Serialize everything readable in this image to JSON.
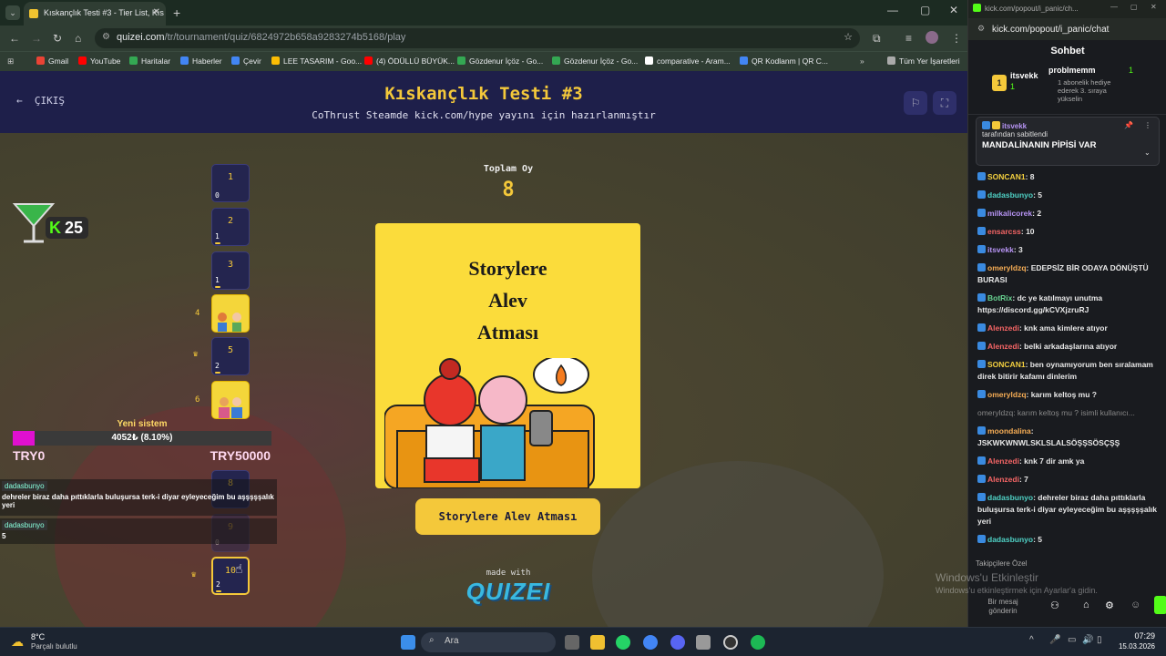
{
  "browser": {
    "tab_title": "Kıskançlık Testi #3 - Tier List, Kıs",
    "url_domain": "quizei.com",
    "url_path": "/tr/tournament/quiz/6824972b658a9283274b5168/play",
    "bookmarks": [
      "Gmail",
      "YouTube",
      "Haritalar",
      "Haberler",
      "Çevir",
      "LEE TASARIM - Goo...",
      "(4) ÖDÜLLÜ BÜYÜK...",
      "Gözdenur İçöz - Go...",
      "Gözdenur İçöz - Go...",
      "comparative - Aram...",
      "QR Kodlanm | QR C..."
    ],
    "bookmarks_all": "Tüm Yer İşaretleri"
  },
  "quiz": {
    "exit_label": "ÇIKIŞ",
    "title": "Kıskançlık Testi #3",
    "subtitle": "CoThrust Steamde kick.com/hype yayını için hazırlanmıştır",
    "votes_label": "Toplam Oy",
    "votes_total": "8",
    "card_text": "Storylere\nAlev\nAtması",
    "answer_label": "Storylere Alev Atması",
    "made_with": "made with",
    "logo": "QUIZEI",
    "slots": [
      {
        "num": "1",
        "count": "0"
      },
      {
        "num": "2",
        "count": "1"
      },
      {
        "num": "3",
        "count": "1"
      },
      {
        "num": "",
        "count": "",
        "label": "4"
      },
      {
        "num": "5",
        "count": "2"
      },
      {
        "num": "",
        "count": "",
        "label": "6"
      },
      {
        "num": "8",
        "count": ""
      },
      {
        "num": "9",
        "count": "0"
      },
      {
        "num": "10",
        "count": "2"
      }
    ]
  },
  "overlay": {
    "goal_count": "25",
    "new_system": "Yeni sistem",
    "progress_text": "4052₺ (8.10%)",
    "progress_fraction": 0.081,
    "left_label": "TRY0",
    "right_label": "TRY50000",
    "chat": [
      {
        "user": "dadasbunyo",
        "text": "dehreler biraz daha pıttıklarla buluşursa terk-i diyar eyleyeceğim bu aşşşşşalık yeri"
      },
      {
        "user": "dadasbunyo",
        "text": "5"
      }
    ]
  },
  "chat": {
    "popout_url_small": "kick.com/popout/i_panic/ch...",
    "popout_url": "kick.com/popout/i_panic/chat",
    "title": "Sohbet",
    "gift_user1": "itsvekk",
    "gift_user1_count": "1",
    "gift_user2": "probImemm",
    "gift_user2_count": "1",
    "gift_note": "1 abonelik hediye ederek 3. sıraya yükselin",
    "pinned_by": "itsvekk",
    "pinned_by_text": "tarafından sabitlendi",
    "pinned_msg": "MANDALİNANIN PİPİSİ VAR",
    "messages": [
      {
        "user": "SONCAN1",
        "color": "#f4d03f",
        "text": ": 8"
      },
      {
        "user": "dadasbunyo",
        "color": "#4fd1c5",
        "text": ": 5"
      },
      {
        "user": "milkalicorek",
        "color": "#b794f4",
        "text": ": 2"
      },
      {
        "user": "ensarcss",
        "color": "#f56565",
        "text": ": 10"
      },
      {
        "user": "itsvekk",
        "color": "#b794f4",
        "text": ": 3"
      },
      {
        "user": "omeryldzq",
        "color": "#f6ad55",
        "text": ": EDEPSİZ BİR ODAYA DÖNÜŞTÜ BURASI"
      },
      {
        "user": "BotRix",
        "color": "#68d391",
        "text": ": dc ye katılmayı unutma https://discord.gg/kCVXjzruRJ"
      },
      {
        "user": "Alenzedi",
        "color": "#f56565",
        "text": ": knk ama kimlere atıyor"
      },
      {
        "user": "Alenzedi",
        "color": "#f56565",
        "text": ": belki arkadaşlarına atıyor"
      },
      {
        "user": "SONCAN1",
        "color": "#f4d03f",
        "text": ": ben oynamıyorum ben sıralamam direk bitirir kafamı dinlerim"
      },
      {
        "user": "omeryldzq",
        "color": "#f6ad55",
        "text": ": karım keltoş mu ?"
      },
      {
        "user": "",
        "color": "#888",
        "text": "omeryldzq: karım keltoş mu ? isimli kullanıcı..."
      },
      {
        "user": "moondalina",
        "color": "#f6ad55",
        "text": ": JSKWKWNWLSKLSLALSÖŞŞSÖSÇŞŞ"
      },
      {
        "user": "Alenzedi",
        "color": "#f56565",
        "text": ": knk 7 dir amk ya"
      },
      {
        "user": "Alenzedi",
        "color": "#f56565",
        "text": ": 7"
      },
      {
        "user": "dadasbunyo",
        "color": "#4fd1c5",
        "text": ": dehreler biraz daha pıttıklarla buluşursa terk-i diyar eyleyeceğim bu aşşşşşalık yeri"
      },
      {
        "user": "dadasbunyo",
        "color": "#4fd1c5",
        "text": ": 5"
      }
    ],
    "followers_only": "Takipçilere Özel",
    "send_label": "Bir mesaj gönderin"
  },
  "os": {
    "watermark1": "Windows'u Etkinleştir",
    "watermark2": "Windows'u etkinleştirmek için Ayarlar'a gidin.",
    "weather_temp": "8°C",
    "weather_desc": "Parçalı bulutlu",
    "search": "Ara",
    "time": "07:29",
    "date": "15.03.2026"
  }
}
